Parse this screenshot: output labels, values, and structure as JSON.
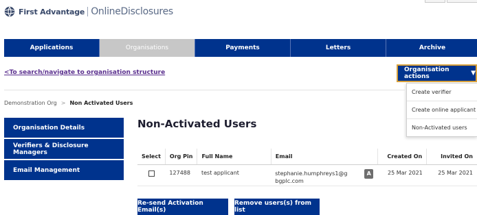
{
  "header": {
    "brand": "First Advantage",
    "product": "OnlineDisclosures"
  },
  "nav": {
    "tabs": [
      {
        "label": "Applications",
        "active": false
      },
      {
        "label": "Organisations",
        "active": true
      },
      {
        "label": "Payments",
        "active": false
      },
      {
        "label": "Letters",
        "active": false
      },
      {
        "label": "Archive",
        "active": false
      }
    ]
  },
  "back_link": "<To search/navigate to organisation structure",
  "org_actions": {
    "label": "Organisation actions",
    "caret": "▼",
    "items": [
      "Create verifier",
      "Create online applicant",
      "Non-Activated users"
    ]
  },
  "breadcrumb": {
    "parent": "Demonstration Org",
    "separator": ">",
    "current": "Non Activated Users"
  },
  "sidebar": {
    "items": [
      "Organisation Details",
      "Verifiers & Disclosure Managers",
      "Email Management"
    ]
  },
  "page_title": "Non-Activated Users",
  "table": {
    "columns": [
      "Select",
      "Org Pin",
      "Full Name",
      "Email",
      "Created On",
      "Invited On"
    ],
    "rows": [
      {
        "org_pin": "127488",
        "full_name": "test applicant",
        "email": "stephanie.humphreys1@gbgplc.com",
        "badge": "A",
        "created_on": "25 Mar 2021",
        "invited_on": "25 Mar 2021"
      }
    ]
  },
  "buttons": {
    "resend": "Re-send Activation Email(s)",
    "remove": "Remove users(s) from list"
  },
  "colors": {
    "primary": "#00338d",
    "inactive_tab": "#c7c7c7",
    "accent_border": "#d9a13b",
    "link": "#5a2f8e"
  }
}
